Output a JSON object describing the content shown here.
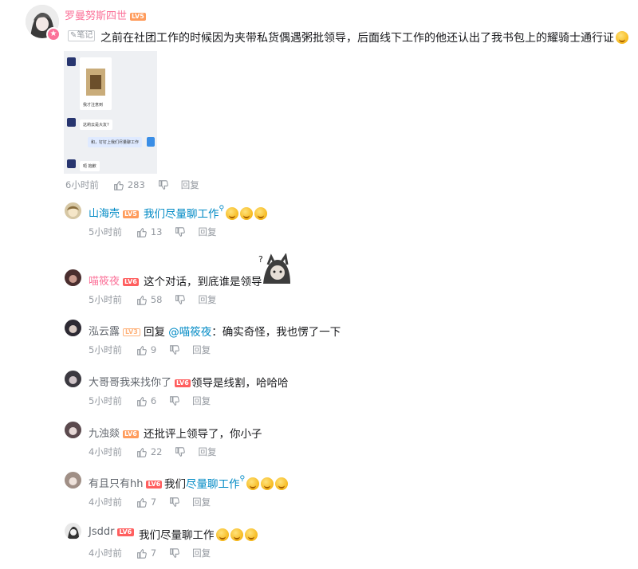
{
  "post": {
    "username": "罗曼努斯四世",
    "level": "LV5",
    "note_tag": "笔记",
    "content": "之前在社团工作的时候因为夹带私货偶遇粥批领导，后面线下工作的他还认出了我书包上的耀骑士通行证",
    "time": "6小时前",
    "likes": "283",
    "reply_label": "回复",
    "chat_screenshot": {
      "caption_1": "我才注意到",
      "question": "这莉云是大友?",
      "reply": "和，钉钉上我们尽量聊工作",
      "ending": "呃 抱歉"
    }
  },
  "replies": [
    {
      "username": "山海壳",
      "level": "LV5",
      "text": "我们尽量聊工作",
      "time": "5小时前",
      "likes": "13",
      "reply_label": "回复"
    },
    {
      "username": "喵筱夜",
      "level": "LV6",
      "text": "这个对话，到底谁是领导",
      "time": "5小时前",
      "likes": "58",
      "reply_label": "回复"
    },
    {
      "username": "泓云露",
      "level": "LV3",
      "prefix": "回复 ",
      "mention": "@喵筱夜",
      "text": "：确实奇怪，我也愣了一下",
      "time": "5小时前",
      "likes": "9",
      "reply_label": "回复"
    },
    {
      "username": "大哥哥我来找你了",
      "level": "LV6",
      "text": "领导是线割，哈哈哈",
      "time": "5小时前",
      "likes": "6",
      "reply_label": "回复"
    },
    {
      "username": "九浊燚",
      "level": "LV6",
      "text": "还批评上领导了，你小子",
      "time": "4小时前",
      "likes": "22",
      "reply_label": "回复"
    },
    {
      "username": "有且只有hh",
      "level": "LV6",
      "text_plain": "我们",
      "text_link": "尽量聊工作",
      "time": "4小时前",
      "likes": "7",
      "reply_label": "回复"
    },
    {
      "username": "Jsddr",
      "level": "LV6",
      "text": "我们尽量聊工作",
      "time": "4小时前",
      "likes": "7",
      "reply_label": "回复"
    }
  ],
  "colors": {
    "link": "#008ac5",
    "meta": "#9499a0",
    "vip_name": "#fb7299"
  },
  "icons": [
    "thumb-up-icon",
    "thumb-down-icon",
    "note-icon",
    "avatar-badge-icon",
    "emoji-icon"
  ]
}
